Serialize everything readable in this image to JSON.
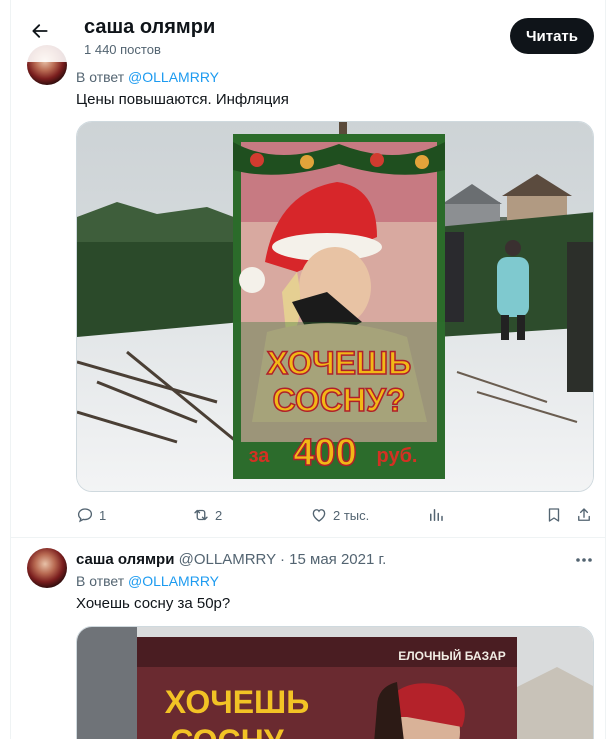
{
  "header": {
    "title": "саша олямри",
    "subtitle": "1 440 постов",
    "read_button": "Читать"
  },
  "tweet1": {
    "reply_prefix": "В ответ",
    "reply_handle": "@OLLAMRRY",
    "text": "Цены повышаются. Инфляция",
    "poster_line1": "ХОЧЕШЬ",
    "poster_line2": "СОСНУ?",
    "poster_price_prefix": "за",
    "poster_price": "400",
    "poster_price_suffix": "руб.",
    "replies": "1",
    "reposts": "2",
    "likes": "2 тыс."
  },
  "tweet2": {
    "name": "саша олямри",
    "handle": "@OLLAMRRY",
    "date": "· 15 мая 2021 г.",
    "reply_prefix": "В ответ",
    "reply_handle": "@OLLAMRRY",
    "text": "Хочешь сосну за 50р?",
    "banner_small": "ЕЛОЧНЫЙ БАЗАР",
    "banner_line1": "ХОЧЕШЬ",
    "banner_line2": "СОСНУ"
  },
  "icons": {
    "back": "arrow-left-icon",
    "reply": "comment-icon",
    "repost": "repost-icon",
    "like": "heart-icon",
    "views": "analytics-icon",
    "bookmark": "bookmark-icon",
    "share": "share-icon",
    "more": "more-dots-icon"
  },
  "colors": {
    "accent": "#1d9bf0",
    "text_primary": "#0f1419",
    "text_secondary": "#536471",
    "button_bg": "#0f1419"
  }
}
